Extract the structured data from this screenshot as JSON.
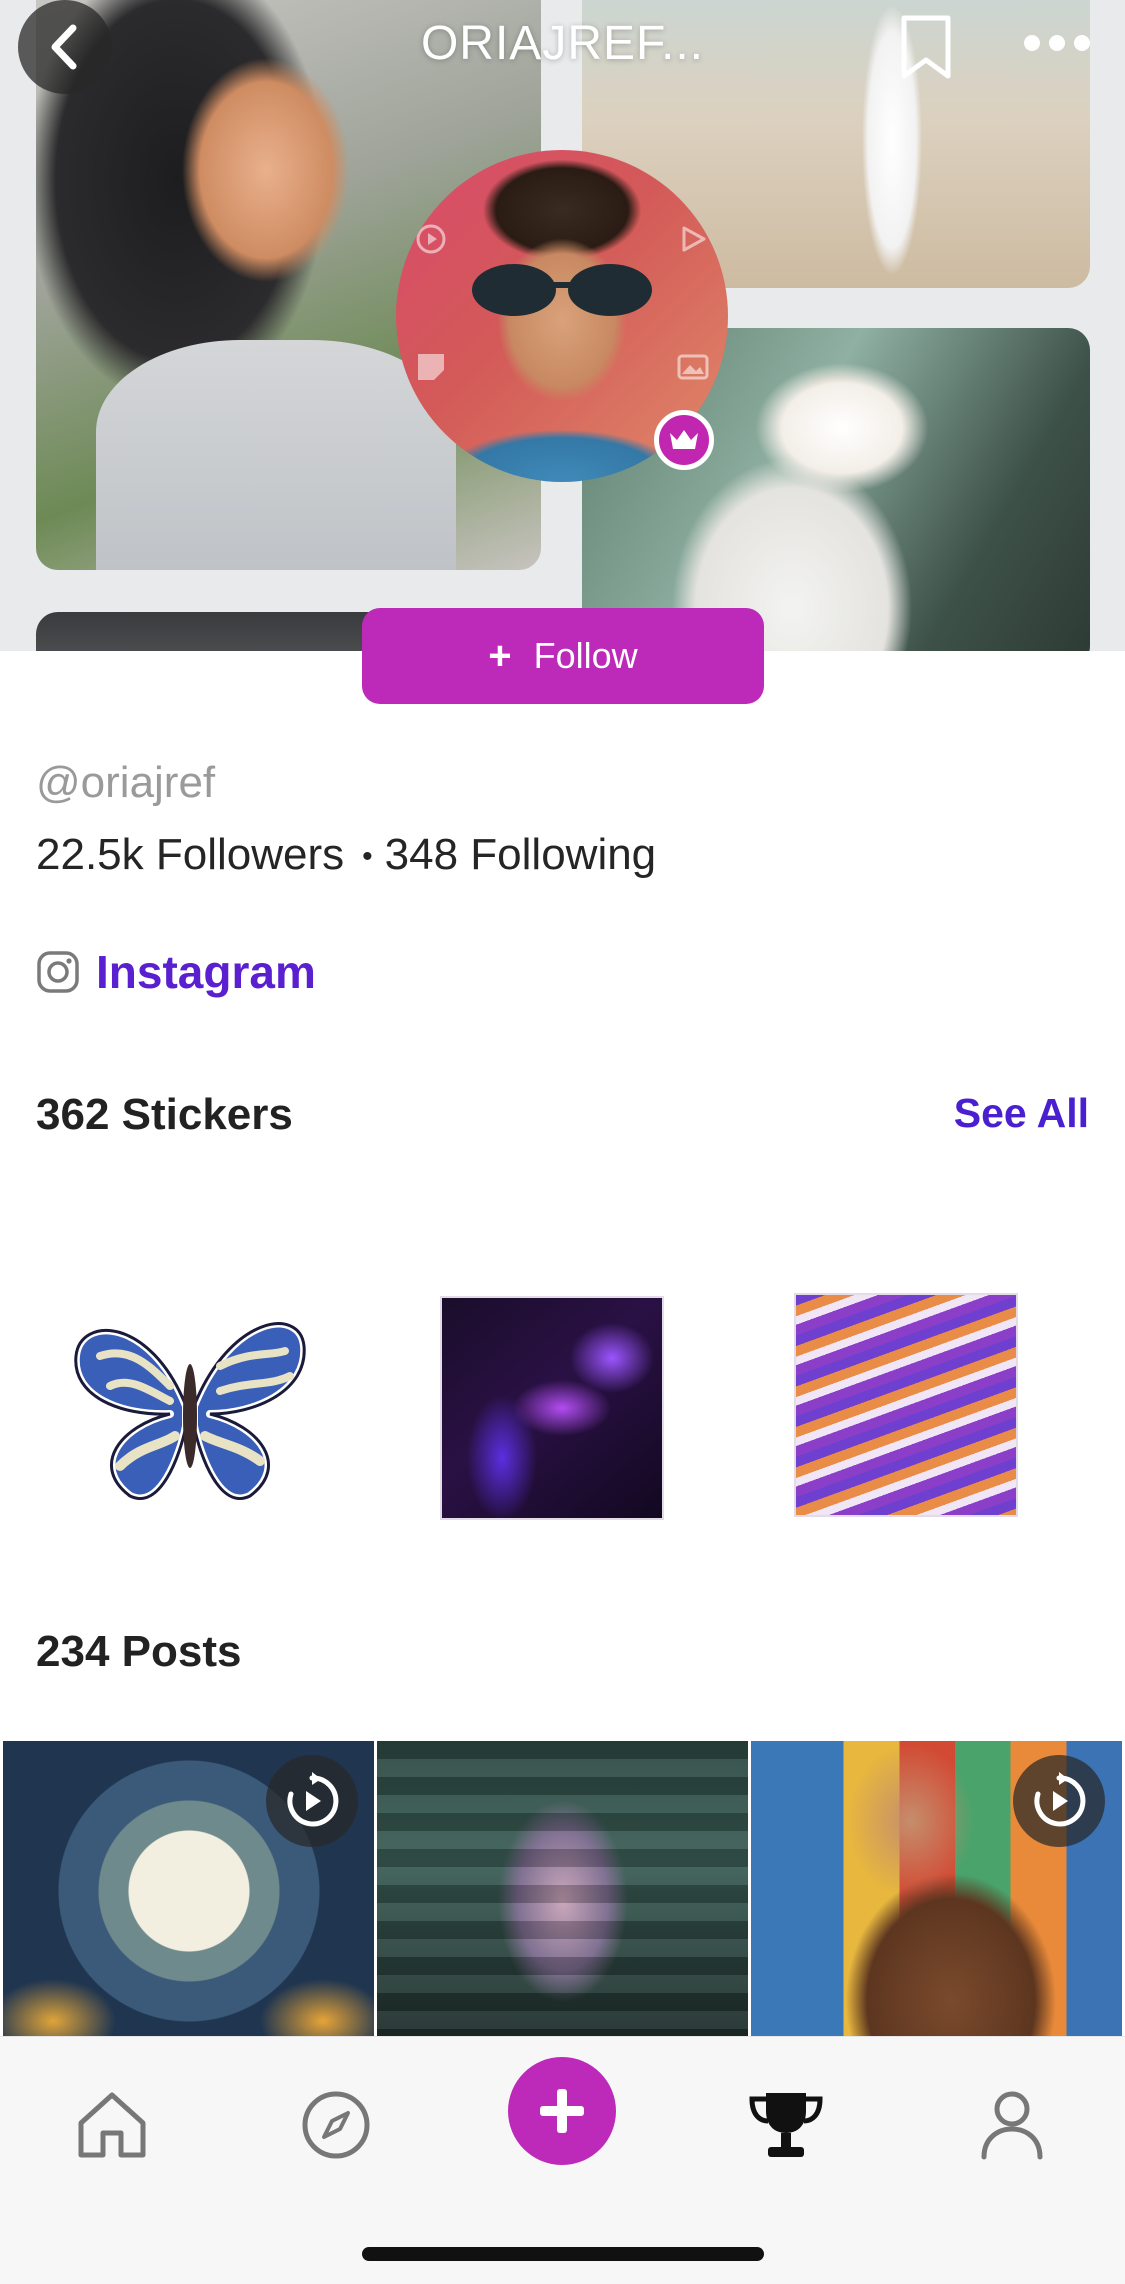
{
  "header": {
    "title": "ORIAJREF...",
    "back_icon": "chevron-left-icon",
    "bookmark_icon": "bookmark-icon",
    "more_icon": "more-horizontal-icon"
  },
  "profile": {
    "follow_label": "Follow",
    "handle": "@oriajref",
    "followers": "22.5k Followers",
    "separator": "•",
    "following": "348 Following",
    "social_label": "Instagram",
    "badge_icon": "crown-icon"
  },
  "stickers": {
    "title": "362 Stickers",
    "see_all": "See All",
    "items": [
      "butterfly-sticker",
      "purple-fluid-sticker",
      "wave-pattern-sticker"
    ]
  },
  "posts": {
    "title": "234 Posts",
    "items": [
      {
        "name": "post-tunnel-art",
        "has_replay": true
      },
      {
        "name": "post-glitch-portrait",
        "has_replay": false
      },
      {
        "name": "post-selfie-collage",
        "has_replay": true
      }
    ]
  },
  "tabbar": {
    "items": [
      "home-icon",
      "explore-icon",
      "create-icon",
      "trophy-icon",
      "profile-icon"
    ]
  },
  "colors": {
    "accent": "#bd2ab9",
    "link": "#5a1fcf",
    "see_all": "#4a1fd0",
    "muted": "#9a9a9a"
  }
}
